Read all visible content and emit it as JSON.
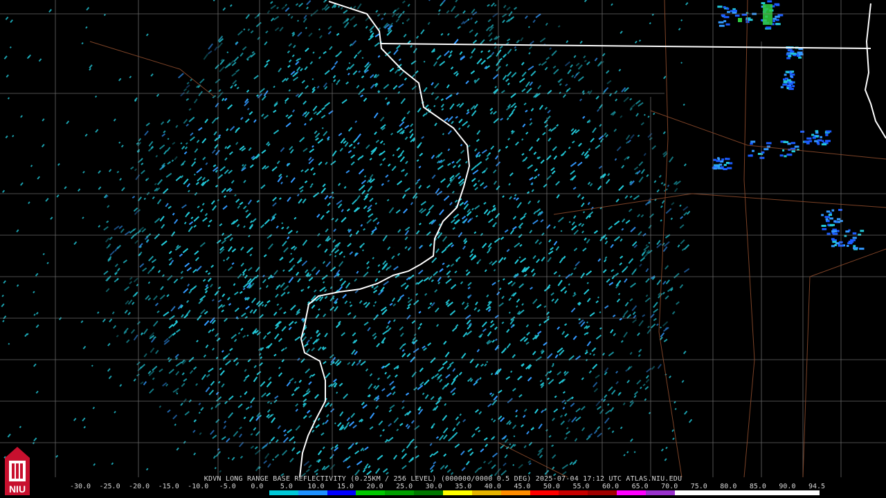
{
  "caption": "KDVN LONG RANGE BASE REFLECTIVITY (0.25KM / 256 LEVEL) (000000/0000 0.5 DEG) 2025-07-04 17:12 UTC  ATLAS.NIU.EDU",
  "logo": {
    "text": "NIU",
    "color": "#c8102e"
  },
  "scale": {
    "labels": [
      "-30.0",
      "-25.0",
      "-20.0",
      "-15.0",
      "-10.0",
      "-5.0",
      "0.0",
      "5.0",
      "10.0",
      "15.0",
      "20.0",
      "25.0",
      "30.0",
      "35.0",
      "40.0",
      "45.0",
      "50.0",
      "55.0",
      "60.0",
      "65.0",
      "70.0",
      "75.0",
      "80.0",
      "85.0",
      "90.0",
      "94.5"
    ],
    "colors": [
      "#000000",
      "#000000",
      "#000000",
      "#000000",
      "#000000",
      "#000000",
      "#000000",
      "#00c8d8",
      "#1e90ff",
      "#0000ff",
      "#00c800",
      "#00a000",
      "#007800",
      "#ffff00",
      "#e6b400",
      "#ff8c00",
      "#ff0000",
      "#c80000",
      "#a00000",
      "#ff00ff",
      "#9932cc",
      "#ffffff",
      "#ffffff",
      "#ffffff",
      "#ffffff",
      "#ffffff"
    ]
  },
  "radar": {
    "site": "KDVN",
    "clutter_color": "#22c8d8",
    "light_echo_color": "#3399ff",
    "heavy_echo_color": "#1a5cff",
    "green_echo_color": "#2ecc40"
  },
  "map_colors": {
    "state_border": "#ffffff",
    "county_border": "#8a8a8a",
    "road": "#8b4a2b"
  }
}
